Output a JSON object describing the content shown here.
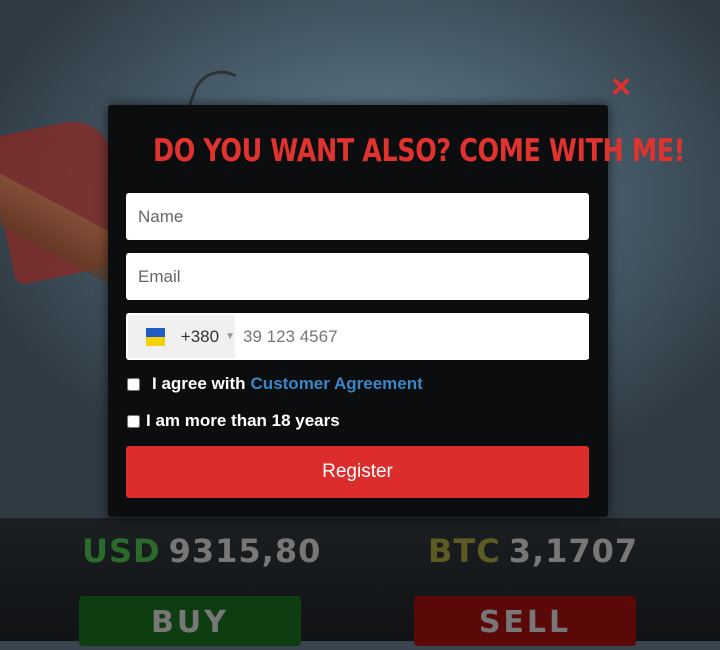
{
  "modal": {
    "title": "Do you want also? Come with me!",
    "close_icon": "×",
    "name_placeholder": "Name",
    "email_placeholder": "Email",
    "phone": {
      "country_flag": "ukraine-flag-icon",
      "dial_code": "+380",
      "placeholder": "39 123 4567"
    },
    "agree_text": "I agree with",
    "agreement_link": "Customer Agreement",
    "age_text": "I am more than 18 years",
    "register_label": "Register"
  },
  "background": {
    "usd_label": "USD",
    "usd_value": "9315,80",
    "btc_label": "BTC",
    "btc_value": "3,1707",
    "buy_label": "BUY",
    "sell_label": "SELL"
  },
  "colors": {
    "accent_red": "#dd2c2c",
    "link_blue": "#3a86c8",
    "modal_bg": "#0c0d0e"
  }
}
